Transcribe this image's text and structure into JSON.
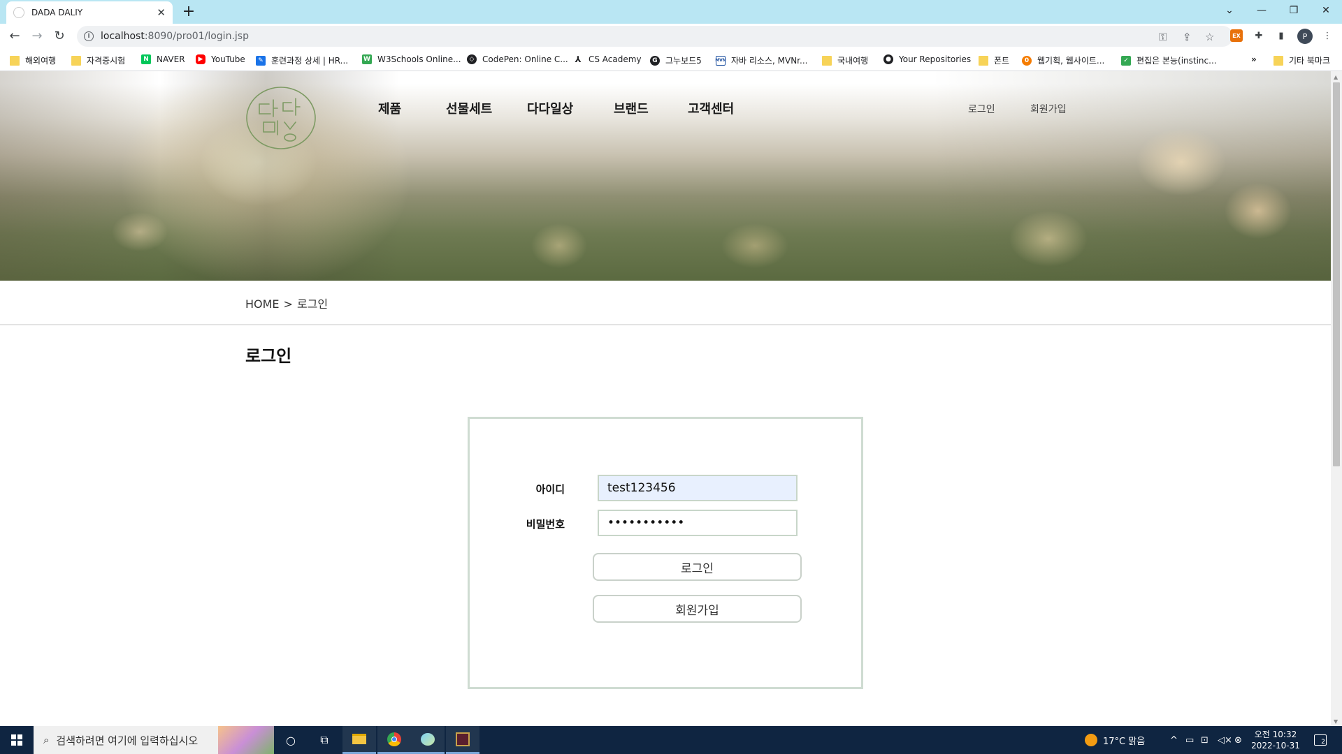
{
  "browser": {
    "tab_title": "DADA DALIY",
    "url_host": "localhost",
    "url_rest": ":8090/pro01/login.jsp",
    "profile_initial": "P",
    "bookmarks": [
      {
        "label": "해외여행",
        "icon": "folder"
      },
      {
        "label": "자격증시험",
        "icon": "folder"
      },
      {
        "label": "NAVER",
        "icon": "naver"
      },
      {
        "label": "YouTube",
        "icon": "youtube"
      },
      {
        "label": "훈련과정 상세 | HR...",
        "icon": "hrd"
      },
      {
        "label": "W3Schools Online...",
        "icon": "w3schools"
      },
      {
        "label": "CodePen: Online C...",
        "icon": "codepen"
      },
      {
        "label": "CS Academy",
        "icon": "cs-academy"
      },
      {
        "label": "그누보드5",
        "icon": "gnuboard"
      },
      {
        "label": "자바 리소스, MVNr...",
        "icon": "mvn"
      },
      {
        "label": "국내여행",
        "icon": "folder"
      },
      {
        "label": "Your Repositories",
        "icon": "github"
      },
      {
        "label": "폰트",
        "icon": "folder"
      },
      {
        "label": "웹기획, 웹사이트...",
        "icon": "web"
      },
      {
        "label": "편집은 본능(instinc...",
        "icon": "check"
      }
    ],
    "bookmarks_overflow": "»",
    "other_bookmarks": "기타 북마크"
  },
  "site": {
    "nav": [
      "제품",
      "선물세트",
      "다다일상",
      "브랜드",
      "고객센터"
    ],
    "util": {
      "login": "로그인",
      "join": "회원가입"
    },
    "breadcrumb": {
      "home": "HOME",
      "sep": ">",
      "current": "로그인"
    },
    "page_title": "로그인",
    "form": {
      "id_label": "아이디",
      "id_value": "test123456",
      "pw_label": "비밀번호",
      "pw_value": "•••••••••••",
      "login_button": "로그인",
      "join_button": "회원가입"
    }
  },
  "taskbar": {
    "search_placeholder": "검색하려면 여기에 입력하십시오",
    "weather": "17°C  맑음",
    "time": "오전 10:32",
    "date": "2022-10-31",
    "notifications": "2"
  }
}
